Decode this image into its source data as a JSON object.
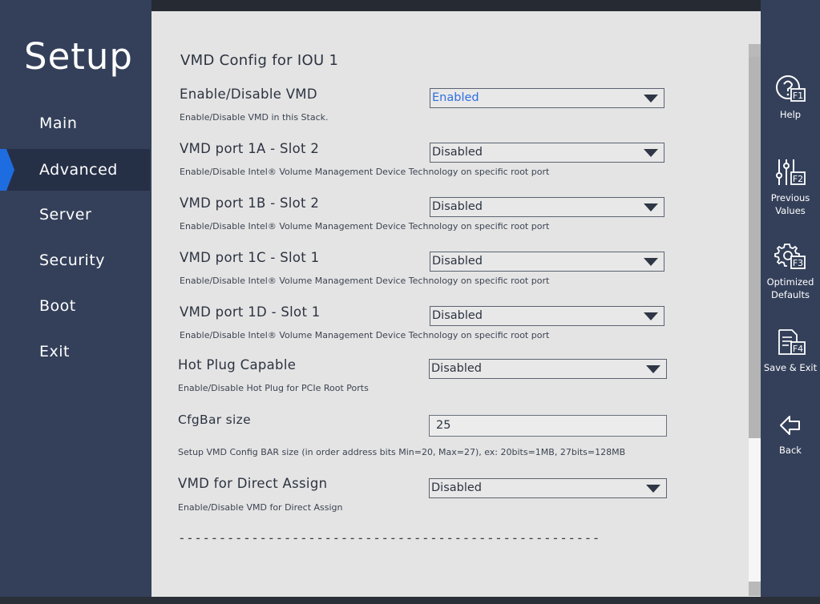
{
  "sidebar": {
    "title": "Setup",
    "items": [
      {
        "label": "Main"
      },
      {
        "label": "Advanced"
      },
      {
        "label": "Server"
      },
      {
        "label": "Security"
      },
      {
        "label": "Boot"
      },
      {
        "label": "Exit"
      }
    ],
    "active_item": "Advanced",
    "active_marker_color": "#1e6de0"
  },
  "main": {
    "section_title": "VMD Config for IOU 1",
    "options": [
      {
        "label": "Enable/Disable VMD",
        "help": "Enable/Disable VMD in this Stack.",
        "value": "Enabled"
      },
      {
        "label": "VMD port 1A - Slot  2",
        "help": "Enable/Disable Intel® Volume Management Device Technology on specific root port",
        "value": "Disabled"
      },
      {
        "label": "VMD port 1B - Slot  2",
        "help": "Enable/Disable Intel® Volume Management Device Technology on specific root port",
        "value": "Disabled"
      },
      {
        "label": "VMD port 1C - Slot  1",
        "help": "Enable/Disable Intel® Volume Management Device Technology on specific root port",
        "value": "Disabled"
      },
      {
        "label": "VMD port 1D - Slot  1",
        "help": "Enable/Disable Intel® Volume Management Device Technology on specific root port",
        "value": "Disabled"
      },
      {
        "label": "Hot Plug Capable",
        "help": "Enable/Disable Hot Plug for PCIe Root Ports",
        "value": "Disabled"
      },
      {
        "label": "CfgBar size",
        "help": "Setup VMD Config BAR size (in order address bits Min=20, Max=27), ex: 20bits=1MB, 27bits=128MB",
        "value": "25"
      },
      {
        "label": "VMD for Direct Assign",
        "help": "Enable/Disable VMD for Direct Assign",
        "value": "Disabled"
      }
    ],
    "separator": "----------------------------------------------------"
  },
  "rightbar": {
    "buttons": [
      {
        "icon": "help-icon",
        "key": "F1",
        "label": "Help"
      },
      {
        "icon": "sliders-icon",
        "key": "F2",
        "label": "Previous Values"
      },
      {
        "icon": "gear-icon",
        "key": "F3",
        "label": "Optimized Defaults"
      },
      {
        "icon": "save-document-icon",
        "key": "F4",
        "label": "Save & Exit"
      },
      {
        "icon": "back-arrow-icon",
        "key": "",
        "label": "Back"
      }
    ]
  },
  "colors": {
    "sidebar_bg": "#34405a",
    "content_bg": "#e4e4e4",
    "highlight_value": "#2f6fe0"
  }
}
